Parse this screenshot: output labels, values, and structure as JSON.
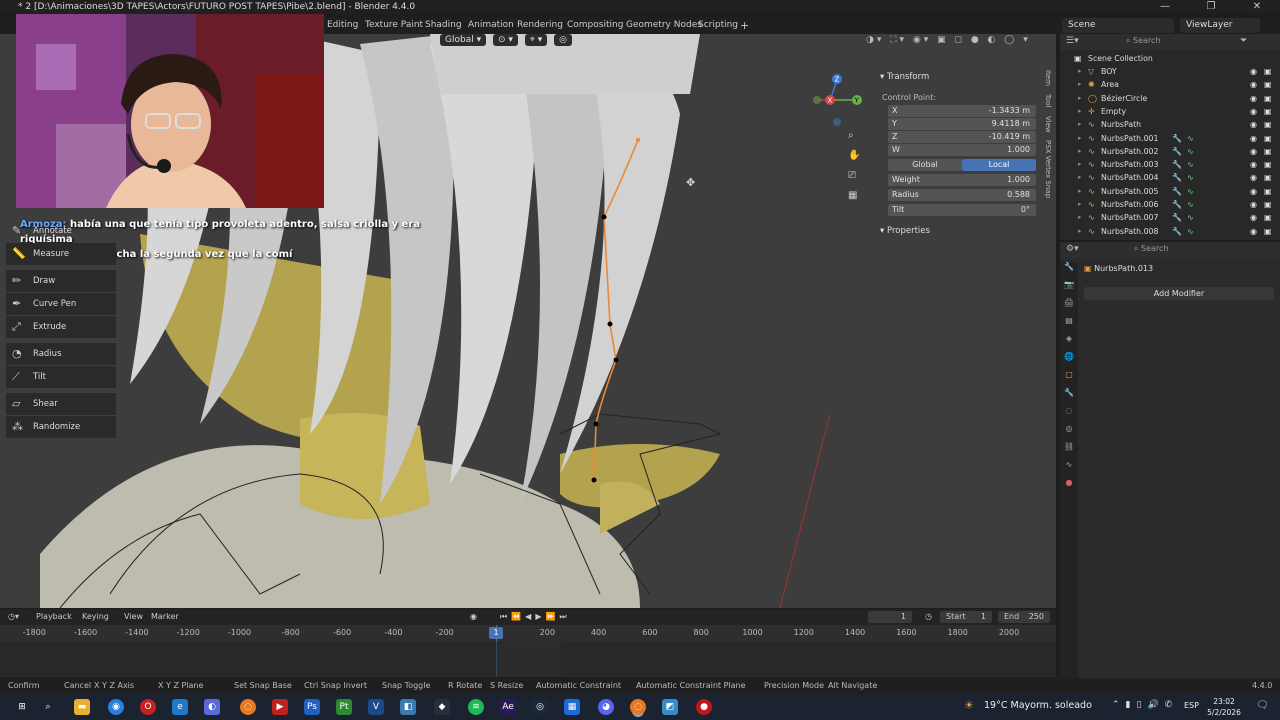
{
  "window": {
    "title": "* 2 [D:\\Animaciones\\3D TAPES\\Actors\\FUTURO POST TAPES\\Pibe\\2.blend] - Blender 4.4.0",
    "minimize": "—",
    "maximize": "❐",
    "close": "✕"
  },
  "workspaces": [
    "Editing",
    "Texture Paint",
    "Shading",
    "Animation",
    "Rendering",
    "Compositing",
    "Geometry Nodes",
    "Scripting",
    "+"
  ],
  "scene_selector": "Scene",
  "viewlayer_selector": "ViewLayer",
  "viewport_header": {
    "orientation": "Global"
  },
  "subtitle": {
    "user": "Armoza:",
    "line1": "había una que tenía tipo provoleta adentro, salsa criolla y era riquísima",
    "line2": "pero me hizo concha la segunda vez que la comí"
  },
  "tools": [
    {
      "label": "Annotate",
      "icon": "annotate-icon"
    },
    {
      "label": "Measure",
      "icon": "measure-icon"
    },
    {
      "label": "Draw",
      "icon": "draw-icon"
    },
    {
      "label": "Curve Pen",
      "icon": "curve-pen-icon"
    },
    {
      "label": "Extrude",
      "icon": "extrude-icon"
    },
    {
      "label": "Radius",
      "icon": "radius-icon"
    },
    {
      "label": "Tilt",
      "icon": "tilt-icon"
    },
    {
      "label": "Shear",
      "icon": "shear-icon"
    },
    {
      "label": "Randomize",
      "icon": "randomize-icon"
    }
  ],
  "npanel": {
    "transform_header": "Transform",
    "control_point_label": "Control Point:",
    "x_label": "X",
    "x": "-1.3433 m",
    "y_label": "Y",
    "y": "9.4118 m",
    "z_label": "Z",
    "z": "-10.419 m",
    "w_label": "W",
    "w": "1.000",
    "global": "Global",
    "local": "Local",
    "weight_label": "Weight",
    "weight": "1.000",
    "radius_label": "Radius",
    "radius": "0.588",
    "tilt_label": "Tilt",
    "tilt": "0°",
    "properties_header": "Properties",
    "side_tabs": [
      "Item",
      "Tool",
      "View",
      "PSX Vertex Snap"
    ]
  },
  "gizmo": {
    "x": "X",
    "y": "Y",
    "z": "Z"
  },
  "outliner": {
    "search_placeholder": "Search",
    "collection": "Scene Collection",
    "items": [
      "BOY",
      "Area",
      "BézierCircle",
      "Empty",
      "NurbsPath",
      "NurbsPath.001",
      "NurbsPath.002",
      "NurbsPath.003",
      "NurbsPath.004",
      "NurbsPath.005",
      "NurbsPath.006",
      "NurbsPath.007",
      "NurbsPath.008"
    ]
  },
  "properties": {
    "search_placeholder": "Search",
    "object_name": "NurbsPath.013",
    "add_modifier": "Add Modifier"
  },
  "timeline": {
    "playback": "Playback",
    "keying": "Keying",
    "view": "View",
    "marker": "Marker",
    "current_frame": "1",
    "start_label": "Start",
    "start": "1",
    "end_label": "End",
    "end": "250",
    "ruler": [
      "-1800",
      "-1600",
      "-1400",
      "-1200",
      "-1000",
      "-800",
      "-600",
      "-400",
      "-200",
      "200",
      "400",
      "600",
      "800",
      "1000",
      "1200",
      "1400",
      "1600",
      "1800",
      "2000"
    ],
    "playhead": "1"
  },
  "statusbar": {
    "items": [
      "Confirm",
      "Cancel",
      "X Y Z Axis",
      "X Y Z Plane",
      "Set Snap Base",
      "Ctrl Snap Invert",
      "Snap Toggle",
      "R Rotate",
      "S Resize",
      "Automatic Constraint",
      "Automatic Constraint Plane",
      "Precision Mode",
      "Alt Navigate"
    ],
    "version": "4.4.0"
  },
  "taskbar": {
    "weather": "19°C  Mayorm. soleado",
    "lang": "ESP",
    "time": "23:02",
    "date": "5/2/2026"
  },
  "colors": {
    "accent": "#4772b3",
    "curve": "#e8893a",
    "viewport_bg": "#3d3d3d",
    "hair": "#c8c8c8",
    "skin_yellow": "#b3a24e"
  }
}
